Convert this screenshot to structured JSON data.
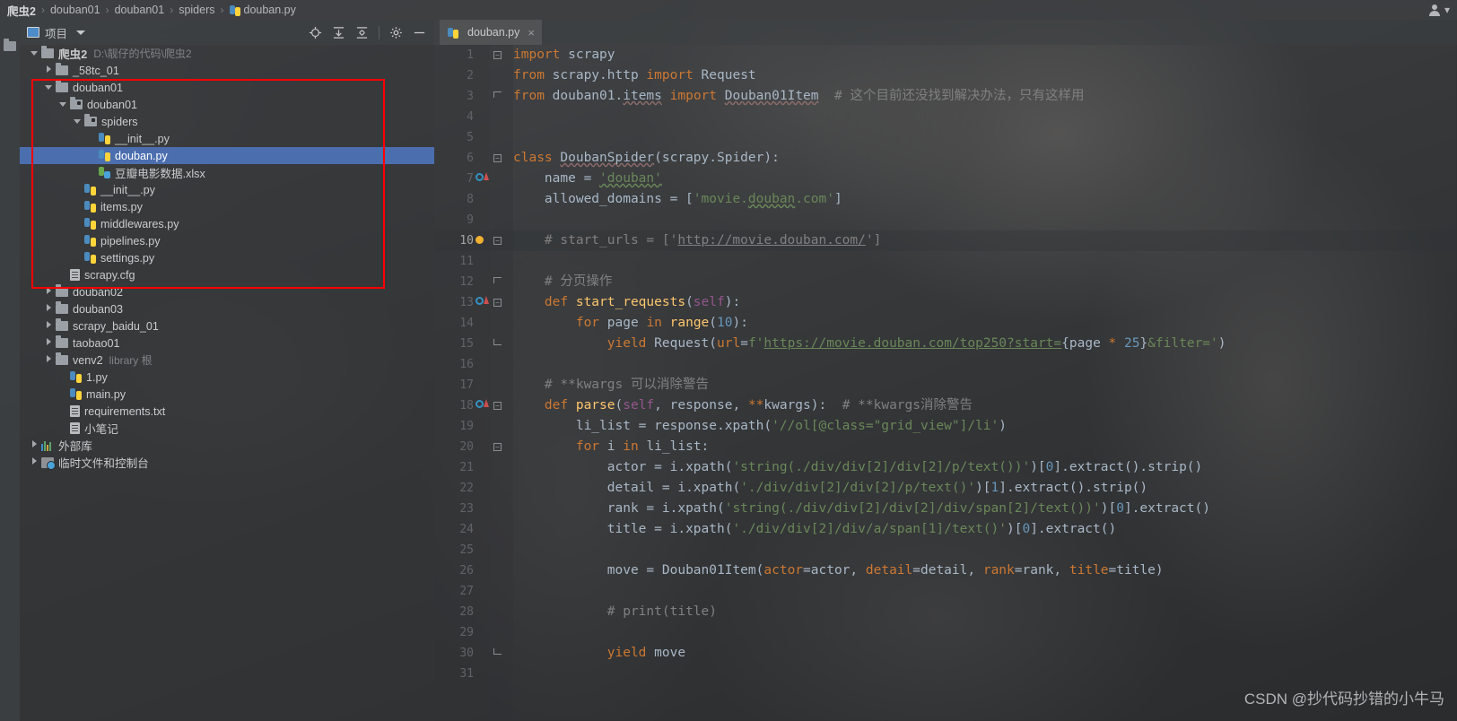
{
  "breadcrumb": {
    "items": [
      {
        "label": "爬虫2",
        "icon": "none",
        "bold": true
      },
      {
        "label": "douban01",
        "icon": "none",
        "bold": false
      },
      {
        "label": "douban01",
        "icon": "none",
        "bold": false
      },
      {
        "label": "spiders",
        "icon": "none",
        "bold": false
      },
      {
        "label": "douban.py",
        "icon": "python-file-icon",
        "bold": false
      }
    ],
    "separator": "›",
    "account_icon": "person-icon",
    "account_caret": "▾"
  },
  "left_strip": {
    "vertical_tab_label": "项目",
    "structure_icon": "structure-icon"
  },
  "project_panel": {
    "title": "项目",
    "window_icon": "project-window-icon",
    "caret": "chevron-down-icon",
    "actions": [
      {
        "name": "locate-icon",
        "title": "定位"
      },
      {
        "name": "expand-all-icon",
        "title": "全部展开"
      },
      {
        "name": "collapse-all-icon",
        "title": "全部折叠"
      },
      {
        "name": "settings-gear-icon",
        "title": "设置"
      },
      {
        "name": "hide-minimize-icon",
        "title": "隐藏"
      }
    ]
  },
  "tree": {
    "rows": [
      {
        "indent": 0,
        "toggle": "down",
        "icon": "folder-icon",
        "label": "爬虫2",
        "dim": "D:\\靓仔的代码\\爬虫2",
        "bold": true,
        "selected": false
      },
      {
        "indent": 1,
        "toggle": "right",
        "icon": "folder-icon",
        "label": "_58tc_01",
        "dim": "",
        "bold": false,
        "selected": false
      },
      {
        "indent": 1,
        "toggle": "down",
        "icon": "folder-icon",
        "label": "douban01",
        "dim": "",
        "bold": false,
        "selected": false
      },
      {
        "indent": 2,
        "toggle": "down",
        "icon": "source-folder-icon",
        "label": "douban01",
        "dim": "",
        "bold": false,
        "selected": false
      },
      {
        "indent": 3,
        "toggle": "down",
        "icon": "source-folder-icon",
        "label": "spiders",
        "dim": "",
        "bold": false,
        "selected": false
      },
      {
        "indent": 4,
        "toggle": "none",
        "icon": "python-file-icon",
        "label": "__init__.py",
        "dim": "",
        "bold": false,
        "selected": false
      },
      {
        "indent": 4,
        "toggle": "none",
        "icon": "python-file-icon",
        "label": "douban.py",
        "dim": "",
        "bold": false,
        "selected": true
      },
      {
        "indent": 4,
        "toggle": "none",
        "icon": "xlsx-file-icon",
        "label": "豆瓣电影数据.xlsx",
        "dim": "",
        "bold": false,
        "selected": false
      },
      {
        "indent": 3,
        "toggle": "none",
        "icon": "python-file-icon",
        "label": "__init__.py",
        "dim": "",
        "bold": false,
        "selected": false
      },
      {
        "indent": 3,
        "toggle": "none",
        "icon": "python-file-icon",
        "label": "items.py",
        "dim": "",
        "bold": false,
        "selected": false
      },
      {
        "indent": 3,
        "toggle": "none",
        "icon": "python-file-icon",
        "label": "middlewares.py",
        "dim": "",
        "bold": false,
        "selected": false
      },
      {
        "indent": 3,
        "toggle": "none",
        "icon": "python-file-icon",
        "label": "pipelines.py",
        "dim": "",
        "bold": false,
        "selected": false
      },
      {
        "indent": 3,
        "toggle": "none",
        "icon": "python-file-icon",
        "label": "settings.py",
        "dim": "",
        "bold": false,
        "selected": false
      },
      {
        "indent": 2,
        "toggle": "none",
        "icon": "text-file-icon",
        "label": "scrapy.cfg",
        "dim": "",
        "bold": false,
        "selected": false
      },
      {
        "indent": 1,
        "toggle": "right",
        "icon": "folder-icon",
        "label": "douban02",
        "dim": "",
        "bold": false,
        "selected": false
      },
      {
        "indent": 1,
        "toggle": "right",
        "icon": "folder-icon",
        "label": "douban03",
        "dim": "",
        "bold": false,
        "selected": false
      },
      {
        "indent": 1,
        "toggle": "right",
        "icon": "folder-icon",
        "label": "scrapy_baidu_01",
        "dim": "",
        "bold": false,
        "selected": false
      },
      {
        "indent": 1,
        "toggle": "right",
        "icon": "folder-icon",
        "label": "taobao01",
        "dim": "",
        "bold": false,
        "selected": false
      },
      {
        "indent": 1,
        "toggle": "right",
        "icon": "folder-icon",
        "label": "venv2",
        "dim": "library 根",
        "bold": false,
        "selected": false
      },
      {
        "indent": 2,
        "toggle": "none",
        "icon": "python-file-icon",
        "label": "1.py",
        "dim": "",
        "bold": false,
        "selected": false
      },
      {
        "indent": 2,
        "toggle": "none",
        "icon": "python-file-icon",
        "label": "main.py",
        "dim": "",
        "bold": false,
        "selected": false
      },
      {
        "indent": 2,
        "toggle": "none",
        "icon": "text-file-icon",
        "label": "requirements.txt",
        "dim": "",
        "bold": false,
        "selected": false
      },
      {
        "indent": 2,
        "toggle": "none",
        "icon": "text-file-icon",
        "label": "小笔记",
        "dim": "",
        "bold": false,
        "selected": false
      },
      {
        "indent": 0,
        "toggle": "right",
        "icon": "external-library-icon",
        "label": "外部库",
        "dim": "",
        "bold": false,
        "selected": false
      },
      {
        "indent": 0,
        "toggle": "right",
        "icon": "scratches-icon",
        "label": "临时文件和控制台",
        "dim": "",
        "bold": false,
        "selected": false
      }
    ]
  },
  "editor": {
    "tab": {
      "label": "douban.py",
      "icon": "python-file-icon",
      "close": "×"
    },
    "lines": [
      {
        "n": 1,
        "marker": "none",
        "fold": "start",
        "html": "<span class='kw'>import</span> <span class='plain'>scrapy</span>"
      },
      {
        "n": 2,
        "marker": "none",
        "fold": "none",
        "html": "<span class='kw'>from</span> <span class='plain'>scrapy.http</span> <span class='kw'>import</span> <span class='plain'>Request</span>"
      },
      {
        "n": 3,
        "marker": "none",
        "fold": "end",
        "html": "<span class='kw'>from</span> <span class='plain'>douban01.</span><span class='err-sq'>items</span> <span class='kw'>import</span> <span class='err-sq'>Douban01Item</span>  <span class='cmt'># 这个目前还没找到解决办法，只有这样用</span>"
      },
      {
        "n": 4,
        "marker": "none",
        "fold": "none",
        "html": ""
      },
      {
        "n": 5,
        "marker": "none",
        "fold": "none",
        "html": ""
      },
      {
        "n": 6,
        "marker": "none",
        "fold": "start",
        "html": "<span class='kw'>class</span> <span class='err-sq'>DoubanSpider</span><span class='plain'>(scrapy.Spider):</span>"
      },
      {
        "n": 7,
        "marker": "run",
        "fold": "none",
        "html": "    <span class='plain'>name = </span><span class='str warn-sq'>'douban'</span>"
      },
      {
        "n": 8,
        "marker": "none",
        "fold": "none",
        "html": "    <span class='plain'>allowed_domains = [</span><span class='str'>'movie.</span><span class='str warn-sq'>douban</span><span class='str'>.com'</span><span class='plain'>]</span>"
      },
      {
        "n": 9,
        "marker": "none",
        "fold": "none",
        "html": ""
      },
      {
        "n": 10,
        "marker": "bulb",
        "fold": "start",
        "html": "    <span class='cmt'># start_urls = ['</span><span class='cmt' style='text-decoration:underline'>http://movie.douban.com/</span><span class='cmt'>']</span>"
      },
      {
        "n": 11,
        "marker": "none",
        "fold": "none",
        "html": ""
      },
      {
        "n": 12,
        "marker": "none",
        "fold": "endtop",
        "html": "    <span class='cmt'># 分页操作</span>"
      },
      {
        "n": 13,
        "marker": "run",
        "fold": "start",
        "html": "    <span class='kw'>def </span><span class='fn'>start_requests</span><span class='plain'>(</span><span class='self'>self</span><span class='plain'>):</span>"
      },
      {
        "n": 14,
        "marker": "none",
        "fold": "none",
        "html": "        <span class='kw'>for</span> <span class='plain'>page</span> <span class='kw'>in</span> <span class='fn'>range</span><span class='plain'>(</span><span class='num'>10</span><span class='plain'>):</span>"
      },
      {
        "n": 15,
        "marker": "none",
        "fold": "endbot",
        "html": "            <span class='kw'>yield</span> <span class='plain'>Request(</span><span class='kw'>url</span><span class='plain'>=</span><span class='str'>f'</span><span class='link'>https://movie.douban.com/top250?start=</span><span class='plain'>{</span><span class='plain'>page </span><span class='kw'>* </span><span class='num'>25</span><span class='plain'>}</span><span class='str'>&amp;filter='</span><span class='plain'>)</span>"
      },
      {
        "n": 16,
        "marker": "none",
        "fold": "none",
        "html": ""
      },
      {
        "n": 17,
        "marker": "none",
        "fold": "none",
        "html": "    <span class='cmt'># **kwargs 可以消除警告</span>"
      },
      {
        "n": 18,
        "marker": "run",
        "fold": "start",
        "html": "    <span class='kw'>def </span><span class='fn'>parse</span><span class='plain'>(</span><span class='self'>self</span><span class='plain'>, response, </span><span class='kw'>**</span><span class='plain'>kwargs):  </span><span class='cmt'># **kwargs消除警告</span>"
      },
      {
        "n": 19,
        "marker": "none",
        "fold": "none",
        "html": "        <span class='plain'>li_list = response.xpath(</span><span class='str'>'//ol[@class=\"grid_view\"]/li'</span><span class='plain'>)</span>"
      },
      {
        "n": 20,
        "marker": "none",
        "fold": "start",
        "html": "        <span class='kw'>for</span> <span class='plain'>i</span> <span class='kw'>in</span> <span class='plain'>li_list:</span>"
      },
      {
        "n": 21,
        "marker": "none",
        "fold": "none",
        "html": "            <span class='plain'>actor = i.xpath(</span><span class='str'>'string(./div/div[2]/div[2]/p/text())'</span><span class='plain'>)[</span><span class='num'>0</span><span class='plain'>].extract().strip()</span>"
      },
      {
        "n": 22,
        "marker": "none",
        "fold": "none",
        "html": "            <span class='plain'>detail = i.xpath(</span><span class='str'>'./div/div[2]/div[2]/p/text()'</span><span class='plain'>)[</span><span class='num'>1</span><span class='plain'>].extract().strip()</span>"
      },
      {
        "n": 23,
        "marker": "none",
        "fold": "none",
        "html": "            <span class='plain'>rank = i.xpath(</span><span class='str'>'string(./div/div[2]/div[2]/div/span[2]/text())'</span><span class='plain'>)[</span><span class='num'>0</span><span class='plain'>].extract()</span>"
      },
      {
        "n": 24,
        "marker": "none",
        "fold": "none",
        "html": "            <span class='plain'>title = i.xpath(</span><span class='str'>'./div/div[2]/div/a/span[1]/text()'</span><span class='plain'>)[</span><span class='num'>0</span><span class='plain'>].extract()</span>"
      },
      {
        "n": 25,
        "marker": "none",
        "fold": "none",
        "html": ""
      },
      {
        "n": 26,
        "marker": "none",
        "fold": "none",
        "html": "            <span class='plain'>move = Douban01Item(</span><span class='kw'>actor</span><span class='plain'>=actor, </span><span class='kw'>detail</span><span class='plain'>=detail, </span><span class='kw'>rank</span><span class='plain'>=rank, </span><span class='kw'>title</span><span class='plain'>=title)</span>"
      },
      {
        "n": 27,
        "marker": "none",
        "fold": "none",
        "html": ""
      },
      {
        "n": 28,
        "marker": "none",
        "fold": "none",
        "html": "            <span class='cmt'># print(title)</span>"
      },
      {
        "n": 29,
        "marker": "none",
        "fold": "none",
        "html": ""
      },
      {
        "n": 30,
        "marker": "none",
        "fold": "endbot",
        "html": "            <span class='kw'>yield</span> <span class='plain'>move</span>"
      },
      {
        "n": 31,
        "marker": "none",
        "fold": "none",
        "html": ""
      }
    ]
  },
  "annotation": {
    "red_box_color": "#ff0000"
  },
  "watermark": {
    "text": "CSDN @抄代码抄错的小牛马"
  }
}
